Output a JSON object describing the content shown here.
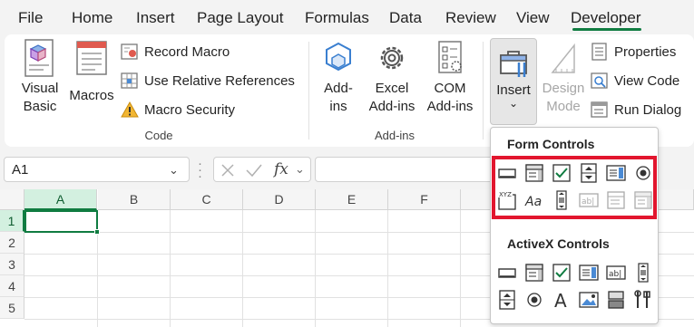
{
  "tabs": [
    "File",
    "Home",
    "Insert",
    "Page Layout",
    "Formulas",
    "Data",
    "Review",
    "View",
    "Developer"
  ],
  "active_tab": "Developer",
  "ribbon": {
    "code_group": {
      "label": "Code",
      "visual_basic": [
        "Visual",
        "Basic"
      ],
      "macros": "Macros",
      "record_macro": "Record Macro",
      "use_relative": "Use Relative References",
      "macro_security": "Macro Security"
    },
    "addins_group": {
      "label": "Add-ins",
      "addins": [
        "Add-",
        "ins"
      ],
      "excel_addins": [
        "Excel",
        "Add-ins"
      ],
      "com_addins": [
        "COM",
        "Add-ins"
      ]
    },
    "controls_group": {
      "insert": "Insert",
      "design_mode": [
        "Design",
        "Mode"
      ],
      "properties": "Properties",
      "view_code": "View Code",
      "run_dialog": "Run Dialog"
    }
  },
  "formula_bar": {
    "name_box": "A1",
    "fx": "fx",
    "formula": ""
  },
  "grid": {
    "columns": [
      "A",
      "B",
      "C",
      "D",
      "E",
      "F"
    ],
    "rows": [
      "1",
      "2",
      "3",
      "4",
      "5"
    ],
    "active_cell": "A1"
  },
  "insert_menu": {
    "form_controls_title": "Form Controls",
    "activex_controls_title": "ActiveX Controls",
    "form_controls": [
      "button-icon",
      "combo-box-icon",
      "check-box-icon",
      "spin-button-icon",
      "list-box-icon",
      "option-button-icon",
      "group-box-icon",
      "label-icon",
      "scroll-bar-icon",
      "text-field-icon",
      "combo-list-edit-icon",
      "combo-dropdown-edit-icon"
    ],
    "activex_controls": [
      "command-button-icon",
      "combo-box-icon",
      "check-box-icon",
      "list-box-icon",
      "text-box-icon",
      "scroll-bar-icon",
      "spin-button-icon",
      "option-button-icon",
      "label-icon",
      "image-icon",
      "toggle-button-icon",
      "more-controls-icon"
    ],
    "highlight_color": "#e2162e"
  },
  "colors": {
    "accent": "#107c41",
    "highlight": "#e2162e"
  }
}
